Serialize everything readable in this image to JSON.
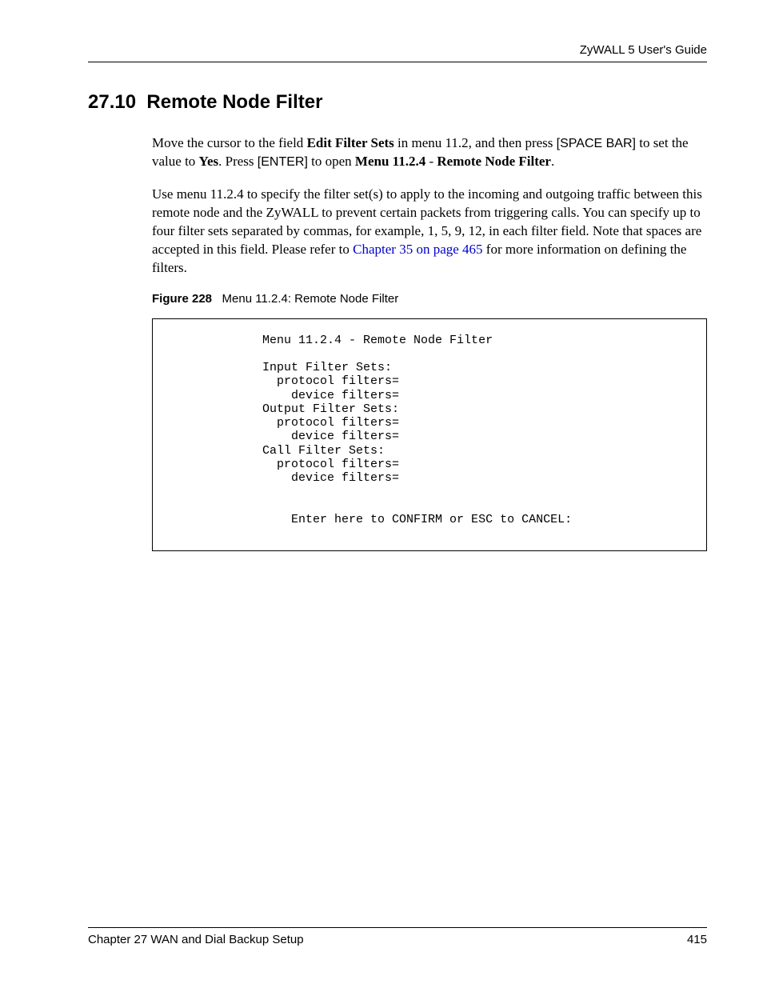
{
  "header": {
    "guide_title": "ZyWALL 5 User's Guide"
  },
  "section": {
    "number": "27.10",
    "title": "Remote Node Filter"
  },
  "para1": {
    "t1": "Move the cursor to the field ",
    "b1": "Edit Filter Sets",
    "t2": " in menu 11.2, and then press ",
    "k1": "[SPACE BAR]",
    "t3": " to set the value to ",
    "b2": "Yes",
    "t4": ". Press ",
    "k2": "[ENTER]",
    "t5": " to open ",
    "b3": "Menu 11.2.4",
    "t6": " - ",
    "b4": "Remote Node Filter",
    "t7": "."
  },
  "para2": {
    "t1": "Use menu 11.2.4 to specify the filter set(s) to apply to the incoming and outgoing traffic between this remote node and the ZyWALL to prevent certain packets from triggering calls. You can specify up to four filter sets separated by commas, for example, 1, 5, 9, 12, in each filter field. Note that spaces are accepted in this field. Please refer to ",
    "link": "Chapter 35 on page 465",
    "t2": " for more information on defining the filters."
  },
  "figure": {
    "label": "Figure 228",
    "caption": "Menu 11.2.4: Remote Node Filter"
  },
  "codebox": "             Menu 11.2.4 - Remote Node Filter\n\n             Input Filter Sets:\n               protocol filters=\n                 device filters=\n             Output Filter Sets:\n               protocol filters=\n                 device filters=\n             Call Filter Sets:\n               protocol filters=\n                 device filters=\n\n\n                 Enter here to CONFIRM or ESC to CANCEL:",
  "footer": {
    "chapter": "Chapter 27 WAN and Dial Backup Setup",
    "page": "415"
  }
}
